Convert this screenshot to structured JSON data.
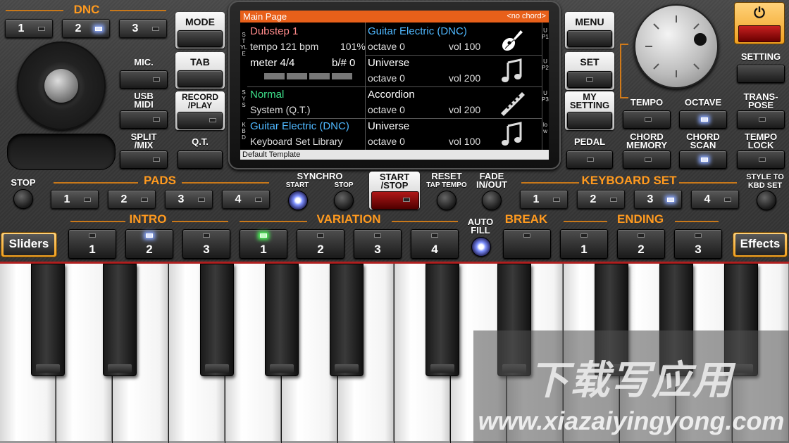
{
  "dnc": {
    "title": "DNC",
    "buttons": [
      {
        "label": "1",
        "led": "off"
      },
      {
        "label": "2",
        "led": "on"
      },
      {
        "label": "3",
        "led": "off"
      }
    ]
  },
  "left_panel": {
    "mic_label": "MIC.",
    "usb_midi_label": "USB\nMIDI",
    "split_mix_label": "SPLIT\n/MIX"
  },
  "center_left": {
    "mode_label": "MODE",
    "tab_label": "TAB",
    "record_play_label": "RECORD\n/PLAY",
    "qt_label": "Q.T."
  },
  "screen": {
    "header_title": "Main Page",
    "header_chord": "<no chord>",
    "side_style_label": "STYLE",
    "side_sys_label": "SYS",
    "side_kbd_label": "KBD",
    "rows": [
      {
        "left_title": "Dubstep 1",
        "left_title_color": "#ff8a8a",
        "left_sub": "tempo 121 bpm",
        "left_sub_right": "101%",
        "voice": "Guitar Electric (DNC)",
        "voice_color": "#4fb8ff",
        "octave": "octave  0",
        "vol": "vol 100",
        "icon": "guitar-icon",
        "part": "UP1"
      },
      {
        "left_title": "meter 4/4",
        "left_title_right": "b/#  0",
        "left_title_color": "#ffffff",
        "voice": "Universe",
        "voice_color": "#ffffff",
        "octave": "octave  0",
        "vol": "vol 200",
        "icon": "music-note-icon",
        "part": "UP2"
      },
      {
        "left_title": "Normal",
        "left_title_color": "#3ee08a",
        "left_sub": "System (Q.T.)",
        "voice": "Accordion",
        "voice_color": "#ffffff",
        "octave": "octave  0",
        "vol": "vol 200",
        "icon": "flute-icon",
        "part": "UP3"
      },
      {
        "left_title": "Guitar Electric (DNC)",
        "left_title_color": "#4fb8ff",
        "left_sub": "Keyboard Set Library",
        "voice": "Universe",
        "voice_color": "#ffffff",
        "octave": "octave  0",
        "vol": "vol 100",
        "icon": "music-note-icon",
        "part": "low"
      }
    ],
    "footer": "Default Template"
  },
  "center_right": {
    "menu_label": "MENU",
    "set_label": "SET",
    "my_setting_label": "MY\nSETTING",
    "pedal_label": "PEDAL"
  },
  "right_panel": {
    "power_icon": "power-icon",
    "setting_label": "SETTING",
    "tempo_label": "TEMPO",
    "octave_label": "OCTAVE",
    "transpose_label": "TRANS-\nPOSE",
    "chord_memory_label": "CHORD\nMEMORY",
    "chord_scan_label": "CHORD\nSCAN",
    "tempo_lock_label": "TEMPO\nLOCK"
  },
  "transport": {
    "stop_label": "STOP",
    "pads_title": "PADS",
    "pads": [
      "1",
      "2",
      "3",
      "4"
    ],
    "synchro_label": "SYNCHRO",
    "synchro_start_label": "START",
    "synchro_stop_label": "STOP",
    "start_stop_label": "START\n/STOP",
    "reset_label": "RESET",
    "tap_tempo_label": "TAP TEMPO",
    "fade_label": "FADE\nIN/OUT",
    "keyboard_set_title": "KEYBOARD SET",
    "keyboard_set": [
      {
        "label": "1",
        "led": "off"
      },
      {
        "label": "2",
        "led": "off"
      },
      {
        "label": "3",
        "led": "on"
      },
      {
        "label": "4",
        "led": "off"
      }
    ],
    "style_to_kbd_label": "STYLE TO\nKBD SET"
  },
  "style_sections": {
    "sliders_label": "Sliders",
    "effects_label": "Effects",
    "intro_title": "INTRO",
    "intro": [
      {
        "label": "1",
        "led": "off"
      },
      {
        "label": "2",
        "led": "on"
      },
      {
        "label": "3",
        "led": "off"
      }
    ],
    "variation_title": "VARIATION",
    "variation": [
      {
        "label": "1",
        "led": "green"
      },
      {
        "label": "2",
        "led": "off"
      },
      {
        "label": "3",
        "led": "off"
      },
      {
        "label": "4",
        "led": "off"
      }
    ],
    "auto_fill_label": "AUTO\nFILL",
    "break_title": "BREAK",
    "ending_title": "ENDING",
    "ending": [
      {
        "label": "1",
        "led": "off"
      },
      {
        "label": "2",
        "led": "off"
      },
      {
        "label": "3",
        "led": "off"
      }
    ]
  },
  "watermark": {
    "cn_text": "下载写应用",
    "url_text": "www.xiazaiyingyong.com"
  },
  "colors": {
    "accent_orange": "#ff9a1f",
    "screen_header": "#e8601a",
    "led_blue": "#8aa8ff",
    "led_green": "#4dff5a"
  }
}
